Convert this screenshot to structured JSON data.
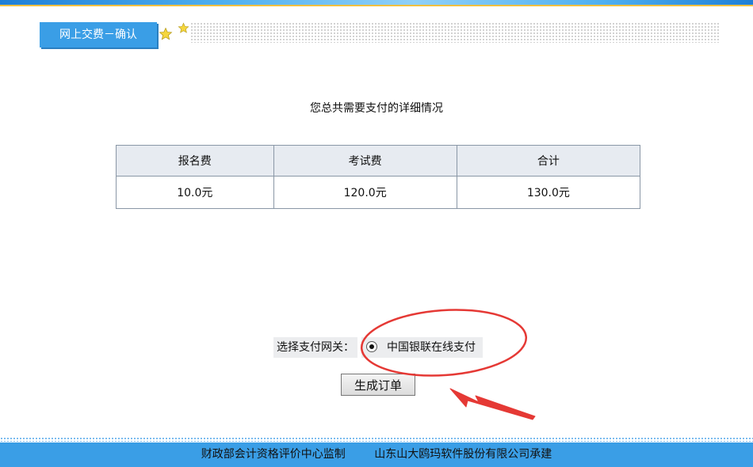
{
  "header": {
    "tab_title": "网上交费－确认"
  },
  "main": {
    "summary_title": "您总共需要支付的详细情况",
    "table": {
      "columns": [
        "报名费",
        "考试费",
        "合计"
      ],
      "rows": [
        [
          "10.0元",
          "120.0元",
          "130.0元"
        ]
      ]
    },
    "gateway": {
      "label": "选择支付网关：",
      "option": "中国银联在线支付",
      "selected": true
    },
    "order_button_label": "生成订单"
  },
  "footer": {
    "supervisor": "财政部会计资格评价中心监制",
    "builder": "山东山大鸥玛软件股份有限公司承建"
  },
  "colors": {
    "accent_blue": "#3a9ee6",
    "annotation_red": "#e53935",
    "star_yellow": "#f5d63d"
  }
}
